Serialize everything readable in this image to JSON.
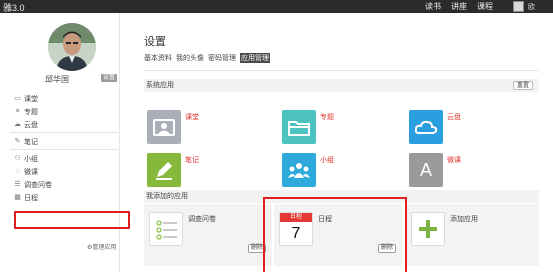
{
  "topbar": {
    "brand": "雅3.0",
    "nav": [
      "读书",
      "讲座",
      "课程"
    ],
    "user_short": "欧"
  },
  "profile": {
    "name": "邱华国",
    "settings_tag": "设置"
  },
  "sidebar": {
    "items": [
      {
        "label": "课堂",
        "icon": "monitor-icon"
      },
      {
        "label": "专题",
        "icon": "stack-icon"
      },
      {
        "label": "云盘",
        "icon": "cloud-icon"
      },
      {
        "label": "笔记",
        "icon": "pencil-icon"
      },
      {
        "label": "小组",
        "icon": "group-icon"
      },
      {
        "label": "微课",
        "icon": "chat-icon"
      },
      {
        "label": "调查问卷",
        "icon": "survey-icon"
      },
      {
        "label": "日程",
        "icon": "calendar-icon"
      }
    ],
    "manage_label": "管理应用"
  },
  "page": {
    "title": "设置",
    "tabs": [
      "基本资料",
      "我的头像",
      "密码管理",
      "应用管理"
    ],
    "active_tab": "应用管理"
  },
  "system_apps": {
    "heading": "系统应用",
    "reset_label": "重置",
    "apps": [
      {
        "label": "课堂",
        "icon": "classroom-icon",
        "color": "#a9aeb8"
      },
      {
        "label": "专题",
        "icon": "folder-icon",
        "color": "#4cc3c0"
      },
      {
        "label": "云盘",
        "icon": "cloud-icon",
        "color": "#2a9fe0"
      },
      {
        "label": "笔记",
        "icon": "note-pencil-icon",
        "color": "#86b83c"
      },
      {
        "label": "小组",
        "icon": "group-icon",
        "color": "#2ea9dc"
      },
      {
        "label": "微课",
        "icon": "letter-a-icon",
        "color": "#9a9a9a"
      }
    ]
  },
  "added_apps": {
    "heading": "我添加的应用",
    "remove_label": "删除",
    "survey": {
      "label": "调查问卷"
    },
    "schedule": {
      "label": "日程",
      "cal_header": "日程",
      "cal_day": "7"
    },
    "add": {
      "label": "添加应用"
    }
  },
  "colors": {
    "topbar": "#2b2b2b",
    "highlight": "#e02020",
    "app_name": "#e0342b",
    "add_green": "#7cb342"
  }
}
